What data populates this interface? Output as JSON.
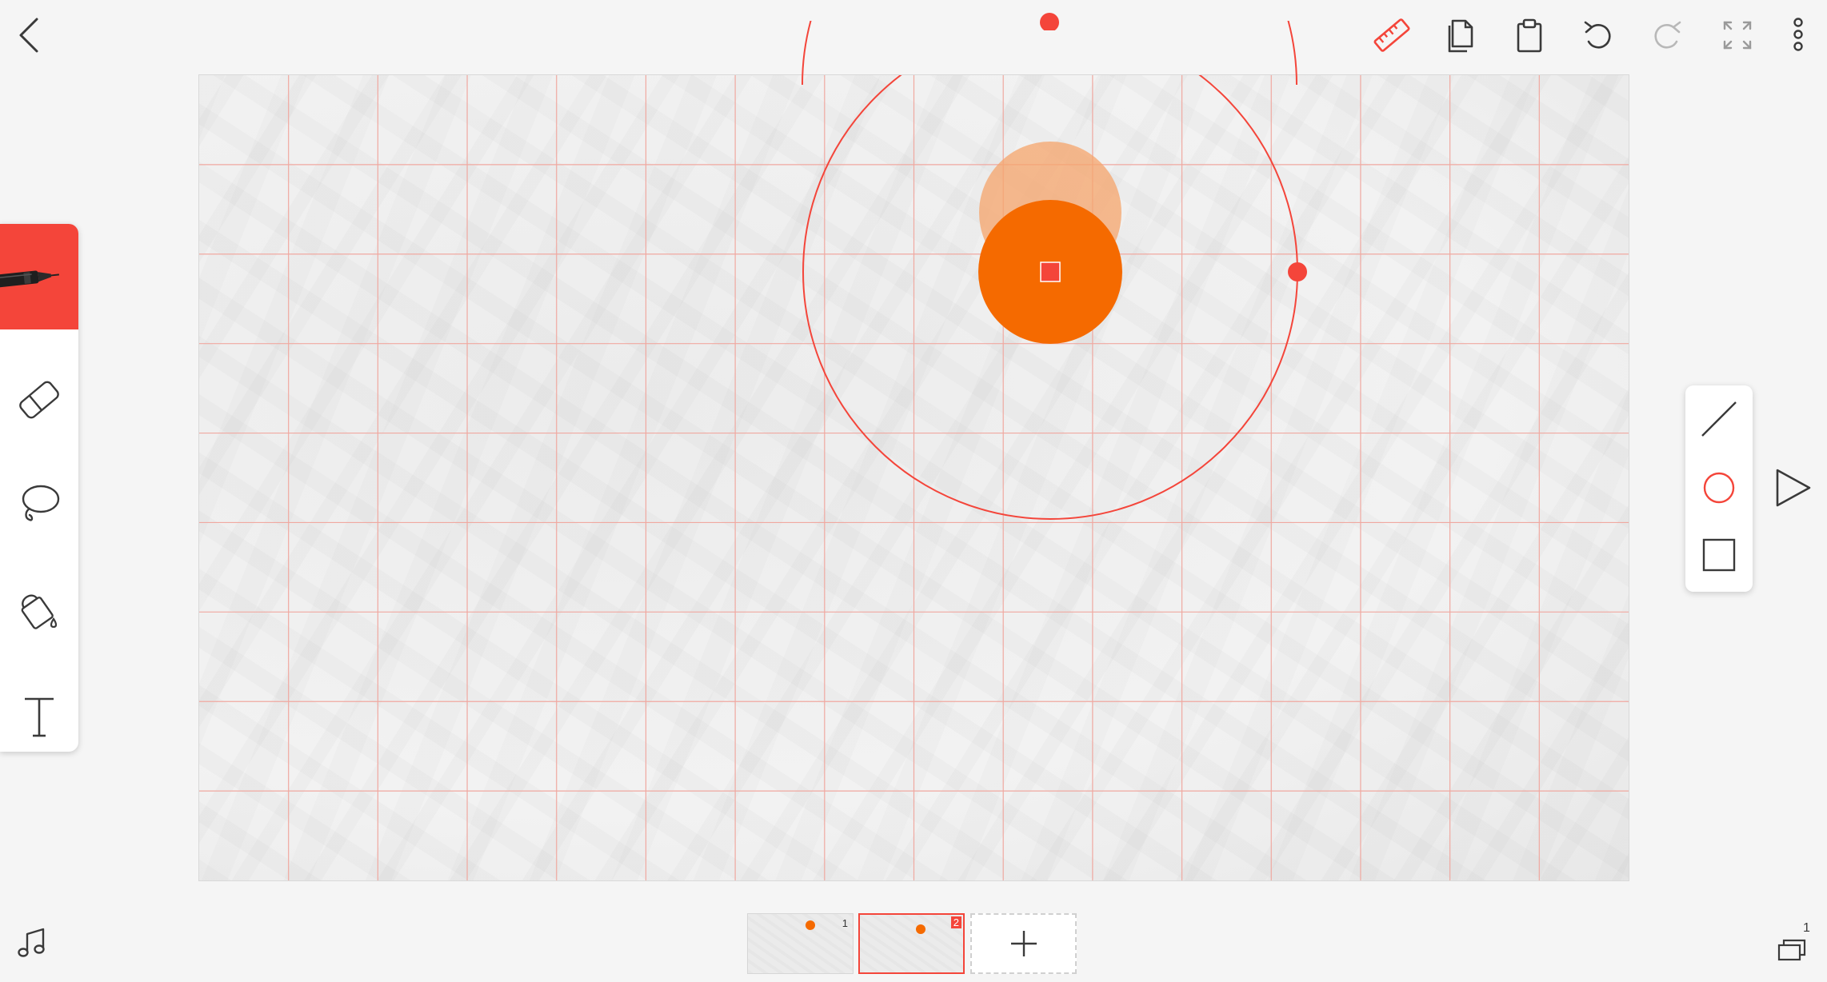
{
  "colors": {
    "accent": "#f4453a",
    "shape_fill": "#f56a00",
    "shape_ghost": "#f5a46b",
    "grid_line": "#f0a8a0",
    "icon": "#3a3a3a",
    "icon_disabled": "#b8b8b8"
  },
  "toolbar": {
    "back_icon": "chevron-left-icon",
    "ruler_icon": "ruler-icon",
    "copy_icon": "copy-icon",
    "paste_icon": "clipboard-icon",
    "undo_icon": "undo-icon",
    "redo_icon": "redo-icon",
    "redo_enabled": false,
    "fullscreen_icon": "fullscreen-icon",
    "more_icon": "more-vertical-icon"
  },
  "tools": [
    {
      "name": "pen",
      "icon": "pen-icon",
      "active": true
    },
    {
      "name": "eraser",
      "icon": "eraser-icon",
      "active": false
    },
    {
      "name": "lasso",
      "icon": "lasso-icon",
      "active": false
    },
    {
      "name": "fill",
      "icon": "paint-bucket-icon",
      "active": false
    },
    {
      "name": "text",
      "icon": "text-icon",
      "active": false
    }
  ],
  "shapes": [
    {
      "name": "line",
      "icon": "line-icon"
    },
    {
      "name": "circle",
      "icon": "circle-icon",
      "selected": true
    },
    {
      "name": "rectangle",
      "icon": "square-icon"
    }
  ],
  "playback": {
    "icon": "play-icon"
  },
  "frames": [
    {
      "number": "1",
      "selected": false
    },
    {
      "number": "2",
      "selected": true
    }
  ],
  "add_frame_icon": "plus-icon",
  "bottom": {
    "music_icon": "music-note-icon",
    "layers_icon": "layers-icon",
    "layers_count": "1"
  }
}
